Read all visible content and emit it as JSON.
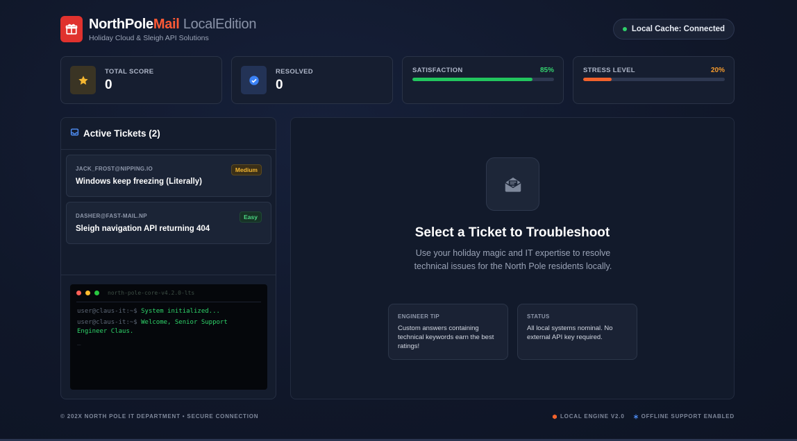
{
  "header": {
    "brand_primary": "NorthPole",
    "brand_accent": "Mail",
    "brand_suffix": " LocalEdition",
    "subtitle": "Holiday Cloud & Sleigh API Solutions",
    "cache_status": "Local Cache: Connected"
  },
  "stats": {
    "score_label": "TOTAL SCORE",
    "score_value": "0",
    "resolved_label": "RESOLVED",
    "resolved_value": "0",
    "satisfaction_label": "SATISFACTION",
    "satisfaction_pct": "85%",
    "satisfaction_value": 85,
    "stress_label": "STRESS LEVEL",
    "stress_pct": "20%",
    "stress_value": 20
  },
  "tickets": {
    "title": "Active Tickets (2)",
    "items": [
      {
        "email": "JACK_FROST@NIPPING.IO",
        "subject": "Windows keep freezing (Literally)",
        "difficulty": "Medium"
      },
      {
        "email": "DASHER@FAST-MAIL.NP",
        "subject": "Sleigh navigation API returning 404",
        "difficulty": "Easy"
      }
    ]
  },
  "terminal": {
    "name": "north-pole-core-v4.2.0-lts",
    "prompt": "user@claus-it:~$",
    "line1": " System initialized...",
    "line2": " Welcome, Senior Support Engineer Claus.",
    "cursor": "_"
  },
  "main": {
    "title": "Select a Ticket to Troubleshoot",
    "description": "Use your holiday magic and IT expertise to resolve technical issues for the North Pole residents locally.",
    "tip_label": "ENGINEER TIP",
    "tip_text": "Custom answers containing technical keywords earn the best ratings!",
    "status_label": "STATUS",
    "status_text": "All local systems nominal. No external API key required."
  },
  "footer": {
    "left": "© 202X NORTH POLE IT DEPARTMENT • SECURE CONNECTION",
    "engine": "LOCAL ENGINE V2.0",
    "offline": "OFFLINE SUPPORT ENABLED"
  },
  "colors": {
    "accent_red": "#e0322e",
    "satisfaction_green": "#22c55e",
    "stress_orange": "#f2622c",
    "badge_medium": "#f5b731",
    "badge_easy": "#4bd883"
  },
  "icons": [
    "gift-icon",
    "star-icon",
    "check-circle-icon",
    "inbox-icon",
    "mail-open-icon",
    "cube-icon",
    "snowflake-icon"
  ]
}
